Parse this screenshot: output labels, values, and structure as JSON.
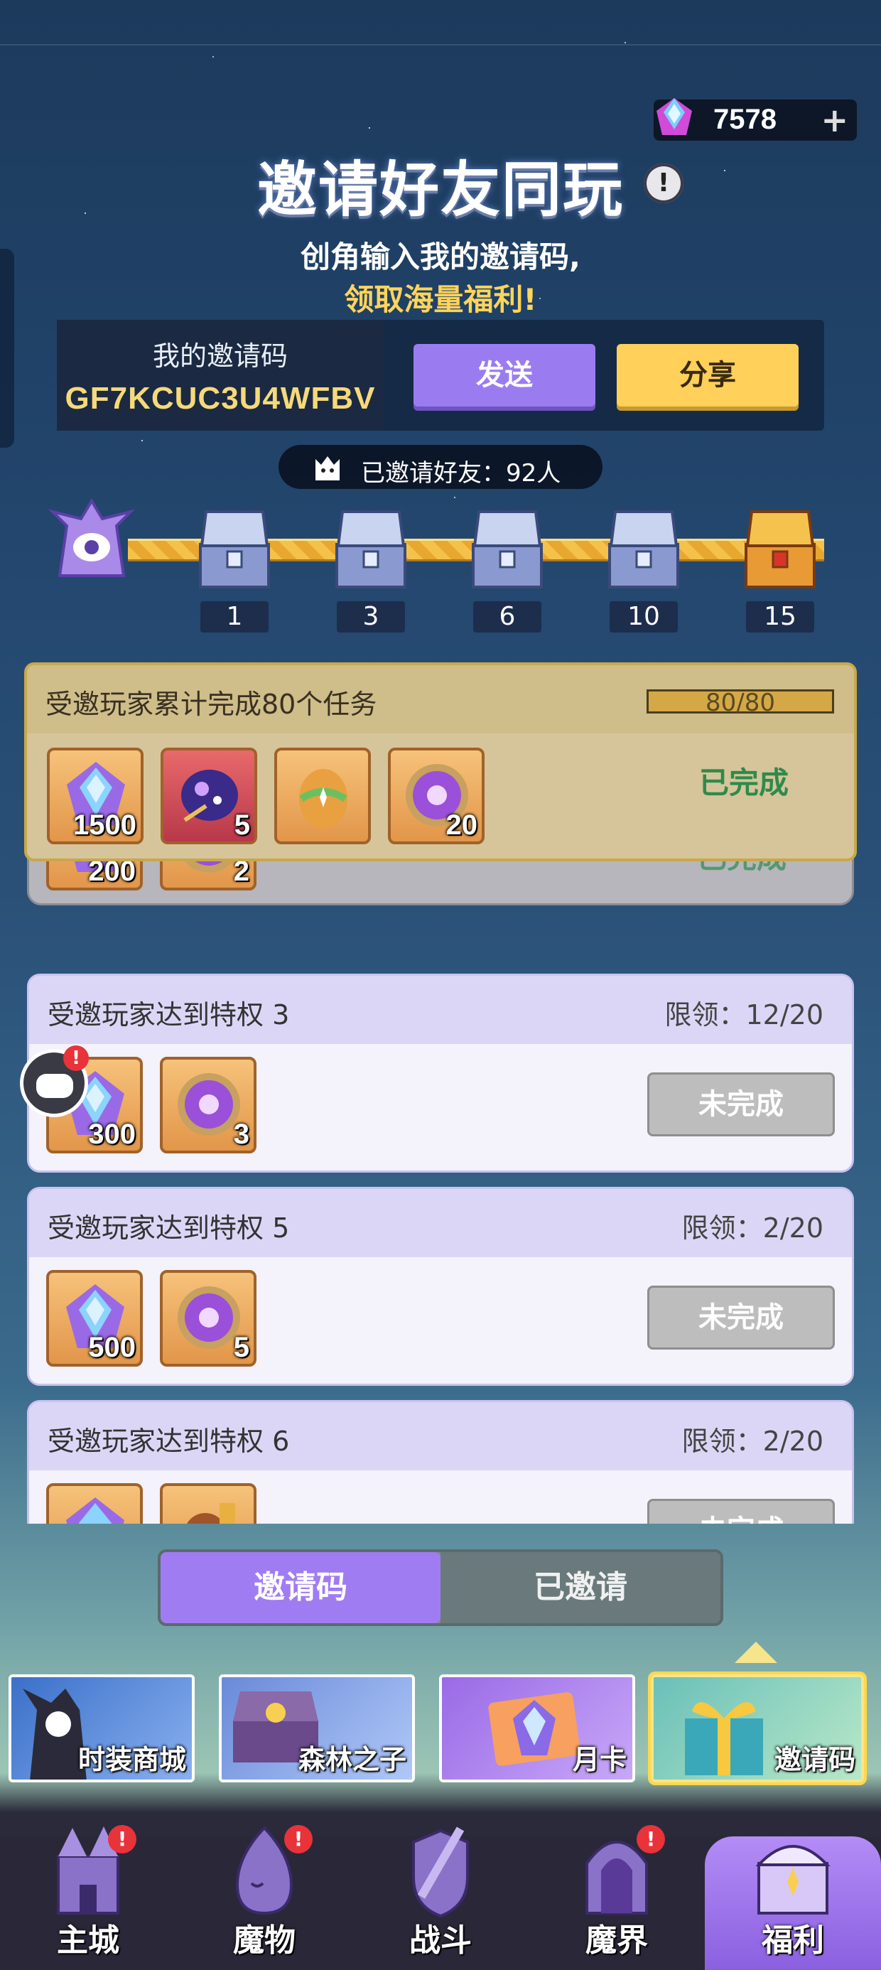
{
  "header": {
    "currency_value": "7578",
    "currency_plus": "+",
    "title": "邀请好友同玩",
    "info": "!",
    "subtitle_line1": "创角输入我的邀请码,",
    "subtitle_line2": "领取海量福利!"
  },
  "invite": {
    "code_label": "我的邀请码",
    "code_value": "GF7KCUC3U4WFBV",
    "send_label": "发送",
    "share_label": "分享",
    "invited_text": "已邀请好友：92人"
  },
  "milestones": [
    "1",
    "3",
    "6",
    "10",
    "15"
  ],
  "tasks": {
    "completed": {
      "title": "受邀玩家累计完成80个任务",
      "progress_text": "80/80",
      "progress": 1.0,
      "status": "已完成",
      "rewards": [
        "1500",
        "5",
        "",
        "20"
      ]
    },
    "hidden": {
      "status": "已完成",
      "rewards": [
        "200",
        "2"
      ]
    },
    "items": [
      {
        "title": "受邀玩家达到特权 3",
        "limit": "限领：12/20",
        "status": "未完成",
        "rewards": [
          "300",
          "3"
        ]
      },
      {
        "title": "受邀玩家达到特权 5",
        "limit": "限领：2/20",
        "status": "未完成",
        "rewards": [
          "500",
          "5"
        ]
      },
      {
        "title": "受邀玩家达到特权 6",
        "limit": "限领：2/20",
        "status": "未完成",
        "rewards": [
          "",
          ""
        ]
      }
    ]
  },
  "tabs": {
    "active": "邀请码",
    "inactive": "已邀请"
  },
  "features": [
    "时装商城",
    "森林之子",
    "月卡",
    "邀请码"
  ],
  "nav": [
    {
      "label": "主城",
      "badge": "!"
    },
    {
      "label": "魔物",
      "badge": "!"
    },
    {
      "label": "战斗",
      "badge": ""
    },
    {
      "label": "魔界",
      "badge": "!"
    },
    {
      "label": "福利",
      "badge": ""
    }
  ],
  "colors": {
    "accent_purple": "#a07cf2",
    "accent_yellow": "#ffd05a",
    "complete_green": "#2f8a4c",
    "badge_red": "#e8333a"
  }
}
